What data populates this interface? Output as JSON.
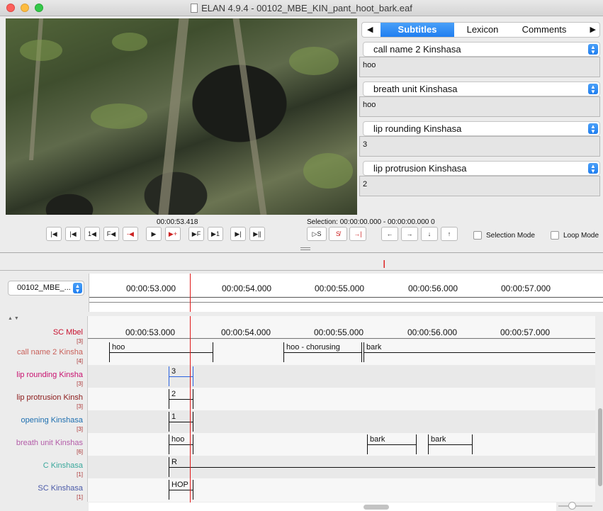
{
  "window": {
    "title": "ELAN 4.9.4 - 00102_MBE_KIN_pant_hoot_bark.eaf"
  },
  "tabs": [
    {
      "label": "Subtitles",
      "active": true
    },
    {
      "label": "Lexicon",
      "active": false
    },
    {
      "label": "Comments",
      "active": false
    }
  ],
  "subtitles": [
    {
      "tier": "call name 2 Kinshasa",
      "value": "hoo"
    },
    {
      "tier": "breath unit Kinshasa",
      "value": "hoo"
    },
    {
      "tier": "lip rounding Kinshasa",
      "value": "3"
    },
    {
      "tier": "lip protrusion Kinshasa",
      "value": "2"
    }
  ],
  "player": {
    "current_time": "00:00:53.418",
    "selection": "Selection: 00:00:00.000 - 00:00:00.000  0"
  },
  "controls": {
    "buttons": [
      "|◀",
      "|◀",
      "1◀",
      "F◀",
      "-◀",
      "▶",
      "▶+",
      "▶F",
      "▶1",
      "▶|",
      "▶||"
    ],
    "selection_buttons": [
      "▷S",
      "S̸",
      "→|"
    ],
    "nav_buttons": [
      "←",
      "→",
      "↓",
      "↑"
    ],
    "selection_mode": "Selection Mode",
    "loop_mode": "Loop Mode"
  },
  "media": {
    "selected": "00102_MBE_..."
  },
  "ruler": {
    "ticks": [
      "00:00:53.000",
      "00:00:54.000",
      "00:00:55.000",
      "00:00:56.000",
      "00:00:57.000"
    ]
  },
  "tiers": [
    {
      "name": "SC Mbel",
      "count": "[3]",
      "color": "#c8102e"
    },
    {
      "name": "call name 2 Kinsha",
      "count": "[4]",
      "color": "#c9605a"
    },
    {
      "name": "lip rounding Kinsha",
      "count": "[3]",
      "color": "#c8106e"
    },
    {
      "name": "lip protrusion Kinsh",
      "count": "[3]",
      "color": "#8b1a1a"
    },
    {
      "name": "opening Kinshasa",
      "count": "[3]",
      "color": "#1e6fb0"
    },
    {
      "name": "breath unit Kinshas",
      "count": "[6]",
      "color": "#b35ca8"
    },
    {
      "name": "C Kinshasa",
      "count": "[1]",
      "color": "#3aa89c"
    },
    {
      "name": "SC Kinshasa",
      "count": "[1]",
      "color": "#4a5aa8"
    }
  ],
  "annotations": {
    "call_hoo": "hoo",
    "call_chorus": "hoo - chorusing",
    "call_bark": "bark",
    "lip_rounding": "3",
    "lip_protrusion": "2",
    "opening": "1",
    "breath_hoo": "hoo",
    "breath_bark1": "bark",
    "breath_bark2": "bark",
    "c": "R",
    "sc": "HOP"
  },
  "colors": {
    "accent": "#1f7ef0",
    "crosshair": "#e01919"
  },
  "icons": {
    "tab_prev": "◀",
    "tab_next": "▶",
    "select_chevron": "⌃⌄"
  }
}
